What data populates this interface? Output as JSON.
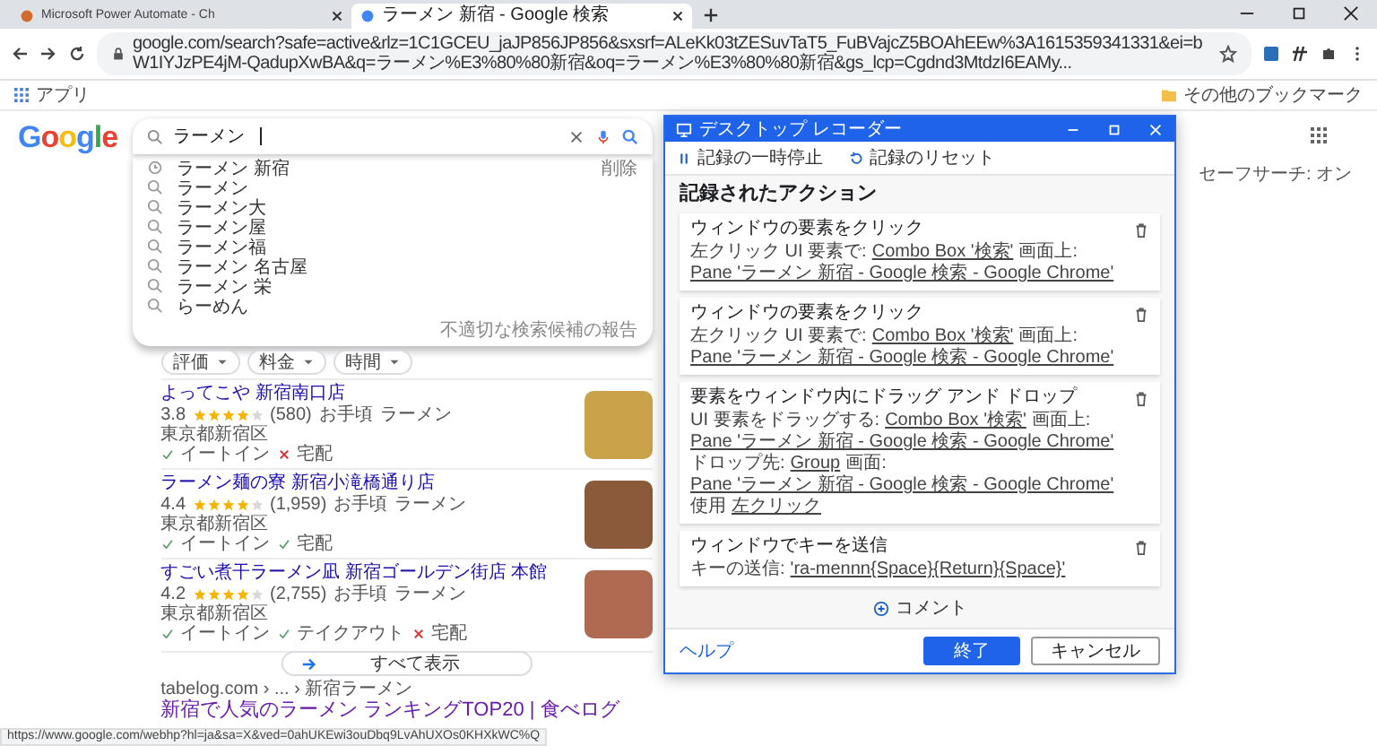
{
  "browser": {
    "tabs": [
      {
        "title": "Microsoft Power Automate - Ch",
        "selected": false
      },
      {
        "title": "ラーメン 新宿 - Google 検索",
        "selected": true
      }
    ],
    "url": "google.com/search?safe=active&rlz=1C1GCEU_jaJP856JP856&sxsrf=ALeKk03tZESuvTaT5_FuBVajcZ5BOAhEEw%3A1615359341331&ei=bW1IYJzPE4jM-QadupXwBA&q=ラーメン%E3%80%80新宿&oq=ラーメン%E3%80%80新宿&gs_lcp=Cgdnd3MtdzI6EAMy...",
    "bookmarks": {
      "apps": "アプリ",
      "other": "その他のブックマーク"
    },
    "status_url": "https://www.google.com/webhp?hl=ja&sa=X&ved=0ahUKEwi3ouDbq9LvAhUXOs0KHXkWC%Q"
  },
  "google": {
    "logo": "Google",
    "query": "ラーメン",
    "safesearch": "セーフサーチ: オン"
  },
  "suggestions": {
    "items": [
      {
        "text": "ラーメン 新宿",
        "kind": "history",
        "action": "削除"
      },
      {
        "text": "ラーメン",
        "kind": "query"
      },
      {
        "text": "ラーメン大",
        "kind": "query"
      },
      {
        "text": "ラーメン屋",
        "kind": "query"
      },
      {
        "text": "ラーメン福",
        "kind": "query"
      },
      {
        "text": "ラーメン 名古屋",
        "kind": "query"
      },
      {
        "text": "ラーメン 栄",
        "kind": "query"
      },
      {
        "text": "らーめん",
        "kind": "query"
      }
    ],
    "report": "不適切な検索候補の報告"
  },
  "filters": [
    "評価",
    "料金",
    "時間"
  ],
  "results": [
    {
      "name": "よってこや 新宿南口店",
      "rating": "3.8",
      "stars": 4,
      "reviews": "(580)",
      "price": "お手頃",
      "category": "ラーメン",
      "area": "東京都新宿区",
      "services": [
        {
          "label": "イートイン",
          "available": true
        },
        {
          "label": "宅配",
          "available": false
        }
      ]
    },
    {
      "name": "ラーメン麺の寮 新宿小滝橋通り店",
      "rating": "4.4",
      "stars": 4,
      "reviews": "(1,959)",
      "price": "お手頃",
      "category": "ラーメン",
      "area": "東京都新宿区",
      "services": [
        {
          "label": "イートイン",
          "available": true
        },
        {
          "label": "宅配",
          "available": true
        }
      ]
    },
    {
      "name": "すごい煮干ラーメン凪 新宿ゴールデン街店 本館",
      "rating": "4.2",
      "stars": 4,
      "reviews": "(2,755)",
      "price": "お手頃",
      "category": "ラーメン",
      "area": "東京都新宿区",
      "services": [
        {
          "label": "イートイン",
          "available": true
        },
        {
          "label": "テイクアウト",
          "available": true
        },
        {
          "label": "宅配",
          "available": false
        }
      ]
    }
  ],
  "show_all": "すべて表示",
  "web_result": {
    "site": "tabelog.com",
    "path": "› ... › 新宿ラーメン",
    "title": "新宿で人気のラーメン ランキングTOP20 | 食べログ"
  },
  "recorder": {
    "title": "デスクトップ レコーダー",
    "toolbar": [
      "記録の一時停止",
      "記録のリセット"
    ],
    "heading": "記録されたアクション",
    "actions": [
      {
        "title": "ウィンドウの要素をクリック",
        "lines": [
          [
            {
              "text": "左クリック UI 要素で:",
              "link": false
            },
            {
              "text": "Combo Box '検索'",
              "link": true
            },
            {
              "text": "画面上:",
              "link": false
            }
          ],
          [
            {
              "text": "Pane 'ラーメン 新宿 - Google 検索 - Google Chrome'",
              "link": true
            }
          ]
        ]
      },
      {
        "title": "ウィンドウの要素をクリック",
        "lines": [
          [
            {
              "text": "左クリック UI 要素で:",
              "link": false
            },
            {
              "text": "Combo Box '検索'",
              "link": true
            },
            {
              "text": "画面上:",
              "link": false
            }
          ],
          [
            {
              "text": "Pane 'ラーメン 新宿 - Google 検索 - Google Chrome'",
              "link": true
            }
          ]
        ]
      },
      {
        "title": "要素をウィンドウ内にドラッグ アンド ドロップ",
        "lines": [
          [
            {
              "text": "UI 要素をドラッグする:",
              "link": false
            },
            {
              "text": "Combo Box '検索'",
              "link": true
            },
            {
              "text": "画面上:",
              "link": false
            }
          ],
          [
            {
              "text": "Pane 'ラーメン 新宿 - Google 検索 - Google Chrome'",
              "link": true
            }
          ],
          [
            {
              "text": "ドロップ先:",
              "link": false
            },
            {
              "text": "Group",
              "link": true
            },
            {
              "text": "画面:",
              "link": false
            }
          ],
          [
            {
              "text": "Pane 'ラーメン 新宿 - Google 検索 - Google Chrome'",
              "link": true
            }
          ],
          [
            {
              "text": "使用",
              "link": false
            },
            {
              "text": "左クリック",
              "link": true
            }
          ]
        ]
      },
      {
        "title": "ウィンドウでキーを送信",
        "lines": [
          [
            {
              "text": "キーの送信:",
              "link": false
            },
            {
              "text": "'ra-mennn{Space}{Return}{Space}'",
              "link": true
            }
          ]
        ]
      }
    ],
    "comment": "コメント",
    "help": "ヘルプ",
    "buttons": [
      {
        "label": "終了",
        "kind": "primary"
      },
      {
        "label": "キャンセル",
        "kind": "secondary"
      }
    ]
  }
}
